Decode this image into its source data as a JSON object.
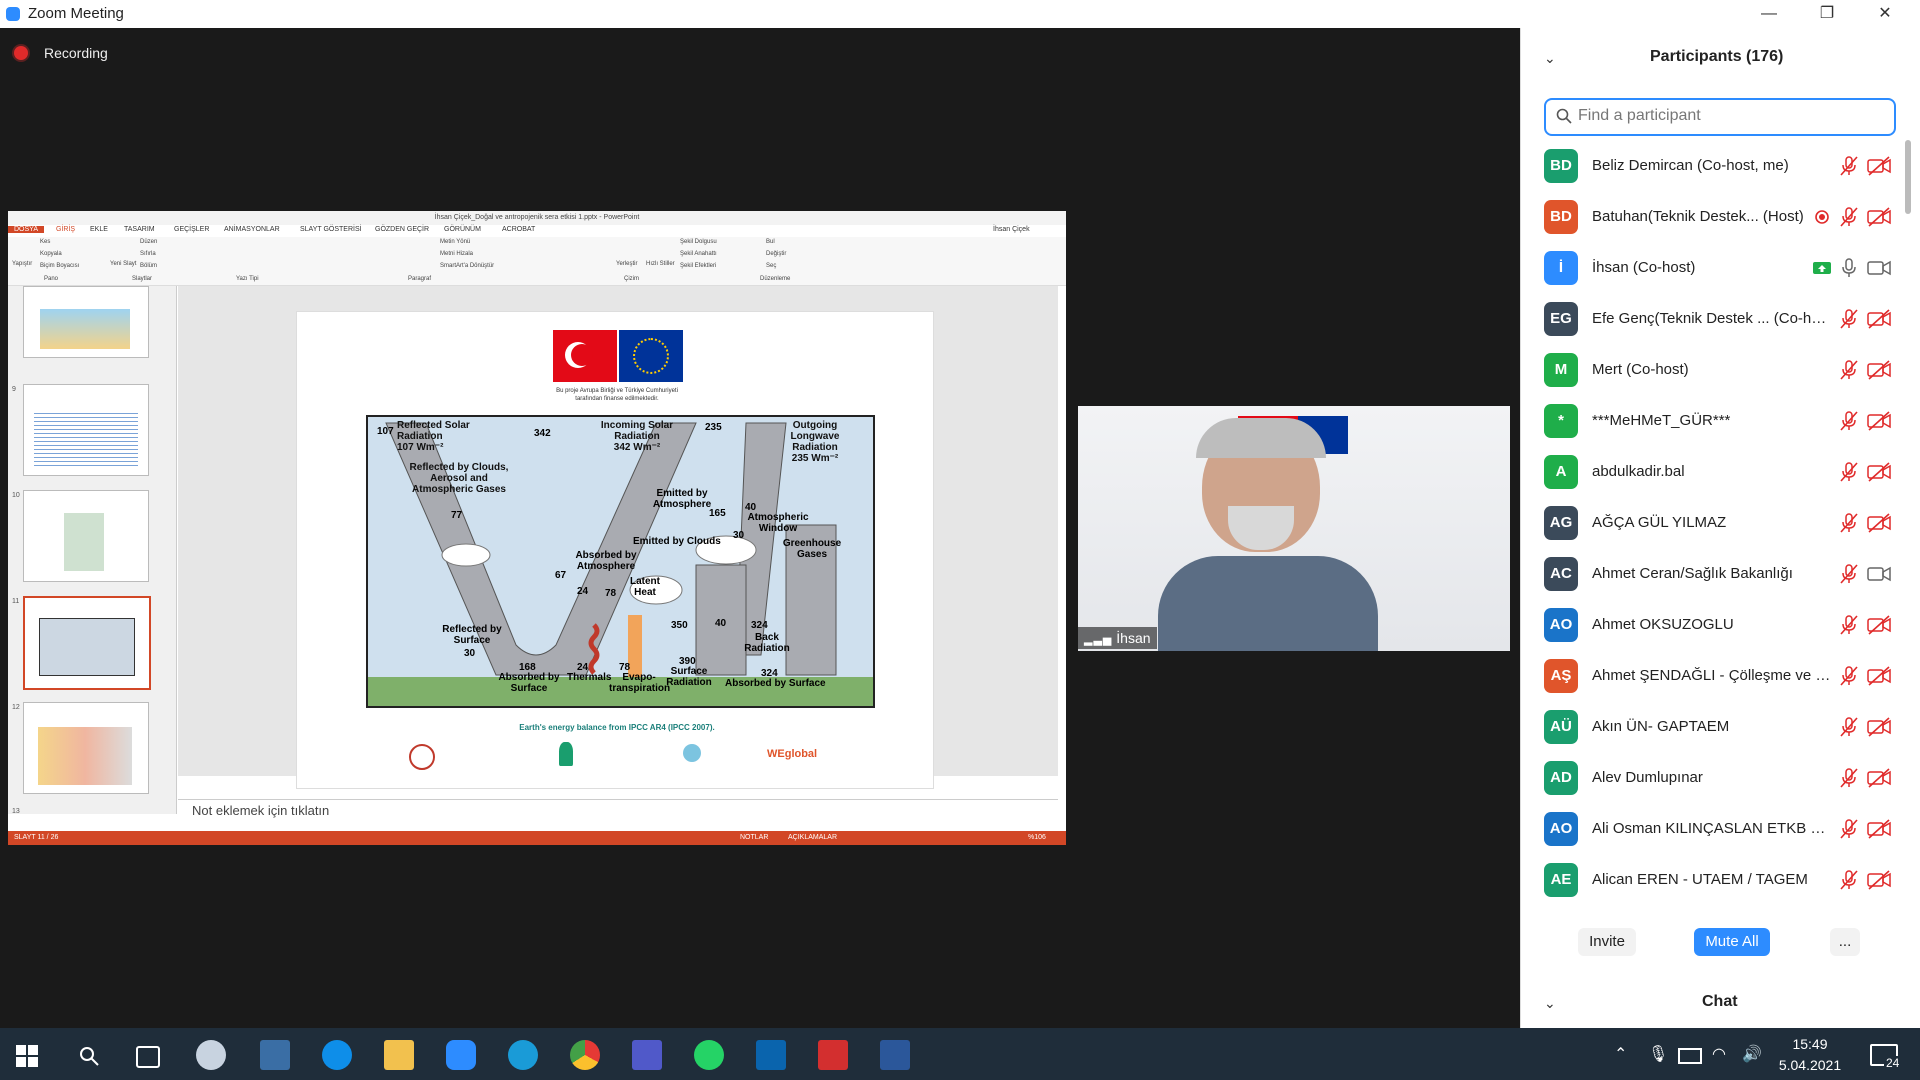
{
  "window": {
    "title": "Zoom Meeting",
    "minimize": "—",
    "restore": "❐",
    "close": "✕"
  },
  "meeting": {
    "recording_label": "Recording"
  },
  "ppt": {
    "title": "İhsan Çiçek_Doğal ve antropojenik sera etkisi 1.pptx - PowerPoint",
    "tabs": [
      "DOSYA",
      "GİRİŞ",
      "EKLE",
      "TASARIM",
      "GEÇİŞLER",
      "ANİMASYONLAR",
      "SLAYT GÖSTERİSİ",
      "GÖZDEN GEÇİR",
      "GÖRÜNÜM",
      "ACROBAT"
    ],
    "user": "İhsan Çiçek",
    "ribbon": {
      "pano": "Pano",
      "yapistir": "Yapıştır",
      "kes": "Kes",
      "kopyala": "Kopyala",
      "bicim": "Biçim Boyacısı",
      "slaytlar": "Slaytlar",
      "yeni_slayt": "Yeni Slayt",
      "duzen": "Düzen",
      "sifirla": "Sıfırla",
      "bolum": "Bölüm",
      "yazi_tipi": "Yazı Tipi",
      "paragraf": "Paragraf",
      "metin_yonu": "Metin Yönü",
      "metni_hizala": "Metni Hizala",
      "smartart": "SmartArt'a Dönüştür",
      "cizim": "Çizim",
      "yerlestir": "Yerleştir",
      "hizli_stiller": "Hızlı Stiller",
      "sekil_dolgusu": "Şekil Dolgusu",
      "sekil_anahati": "Şekil Anahattı",
      "sekil_efektleri": "Şekil Efektleri",
      "duzenleme": "Düzenleme",
      "bul": "Bul",
      "degistir": "Değiştir",
      "sec": "Seç"
    },
    "thumbs": [
      "9",
      "10",
      "11",
      "12",
      "13"
    ],
    "notes_placeholder": "Not eklemek için tıklatın",
    "status": {
      "slide": "SLAYT 11 / 26",
      "notlar": "NOTLAR",
      "aciklamalar": "AÇIKLAMALAR",
      "zoom": "%106"
    }
  },
  "slide": {
    "funding_line1": "Bu proje Avrupa Birliği ve Türkiye Cumhuriyeti",
    "funding_line2": "tarafından finanse edilmektedir.",
    "caption": "Earth's energy balance from IPCC AR4 (IPCC 2007).",
    "logo_text": "WEglobal",
    "diagram": {
      "reflected_solar": "Reflected Solar Radiation",
      "reflected_solar_val": "107 Wm⁻²",
      "n107": "107",
      "n342": "342",
      "incoming": "Incoming Solar Radiation",
      "incoming_val": "342 Wm⁻²",
      "n235": "235",
      "outgoing": "Outgoing Longwave Radiation",
      "outgoing_val": "235 Wm⁻²",
      "reflected_clouds": "Reflected by Clouds, Aerosol and Atmospheric Gases",
      "n77": "77",
      "emitted_atm": "Emitted by Atmosphere",
      "n165": "165",
      "n30a": "30",
      "n40a": "40",
      "window": "Atmospheric Window",
      "emitted_clouds": "Emitted by Clouds",
      "absorbed_atm": "Absorbed by Atmosphere",
      "n67": "67",
      "greenhouse": "Greenhouse Gases",
      "latent": "Latent Heat",
      "n78a": "78",
      "n24a": "24",
      "reflected_surface": "Reflected by Surface",
      "n30b": "30",
      "n350": "350",
      "n40b": "40",
      "n324a": "324",
      "back": "Back Radiation",
      "n168": "168",
      "absorbed_surface": "Absorbed by Surface",
      "n24b": "24",
      "thermals": "Thermals",
      "n78b": "78",
      "evapo": "Evapo-transpiration",
      "n390": "390",
      "surface_rad": "Surface Radiation",
      "n324b": "324",
      "absorbed_surface2": "Absorbed by Surface"
    }
  },
  "video": {
    "name": "İhsan"
  },
  "participants": {
    "title": "Participants (176)",
    "search_placeholder": "Find a participant",
    "list": [
      {
        "initials": "BD",
        "name": "Beliz Demircan (Co-host, me)",
        "color": "#1a9e6e",
        "mic": "muted",
        "cam": "off"
      },
      {
        "initials": "BD",
        "name": "Batuhan(Teknik Destek... (Host)",
        "color": "#e0552b",
        "mic": "muted",
        "cam": "off",
        "extra": "record"
      },
      {
        "initials": "İ",
        "name": "İhsan (Co-host)",
        "color": "#2d8cff",
        "mic": "on",
        "cam": "on",
        "extra": "share"
      },
      {
        "initials": "EG",
        "name": "Efe Genç(Teknik Destek ... (Co-host)",
        "color": "#3b4a5a",
        "mic": "muted",
        "cam": "off"
      },
      {
        "initials": "M",
        "name": "Mert (Co-host)",
        "color": "#1fae4a",
        "mic": "muted",
        "cam": "off"
      },
      {
        "initials": "*",
        "name": "***MeHMeT_GÜR***",
        "color": "#1fae4a",
        "mic": "muted",
        "cam": "off"
      },
      {
        "initials": "A",
        "name": "abdulkadir.bal",
        "color": "#1fae4a",
        "mic": "muted",
        "cam": "off"
      },
      {
        "initials": "AG",
        "name": "AĞÇA GÜL YILMAZ",
        "color": "#3b4a5a",
        "mic": "muted",
        "cam": "off"
      },
      {
        "initials": "AC",
        "name": "Ahmet Ceran/Sağlık Bakanlığı",
        "color": "#3b4a5a",
        "mic": "muted",
        "cam": "on"
      },
      {
        "initials": "AO",
        "name": "Ahmet OKSUZOGLU",
        "color": "#1a74c9",
        "mic": "muted",
        "cam": "off"
      },
      {
        "initials": "AŞ",
        "name": "Ahmet ŞENDAĞLI - Çölleşme ve E...",
        "color": "#e0552b",
        "mic": "muted",
        "cam": "off"
      },
      {
        "initials": "AÜ",
        "name": "Akın ÜN- GAPTAEM",
        "color": "#1a9e6e",
        "mic": "muted",
        "cam": "off"
      },
      {
        "initials": "AD",
        "name": "Alev Dumlupınar",
        "color": "#1a9e6e",
        "mic": "muted",
        "cam": "off"
      },
      {
        "initials": "AO",
        "name": "Ali Osman KILINÇASLAN ETKB Uz...",
        "color": "#1a74c9",
        "mic": "muted",
        "cam": "off"
      },
      {
        "initials": "AE",
        "name": "Alican EREN - UTAEM / TAGEM",
        "color": "#1a9e6e",
        "mic": "muted",
        "cam": "off"
      }
    ],
    "invite_label": "Invite",
    "mute_all_label": "Mute All",
    "more_label": "...",
    "chat_label": "Chat"
  },
  "taskbar": {
    "time": "15:49",
    "date": "5.04.2021",
    "notification_count": "24"
  },
  "colors": {
    "accent": "#2d8cff",
    "ppt_red": "#d24726",
    "muted_red": "#e02a2a",
    "taskbar": "#1f2d3a"
  }
}
